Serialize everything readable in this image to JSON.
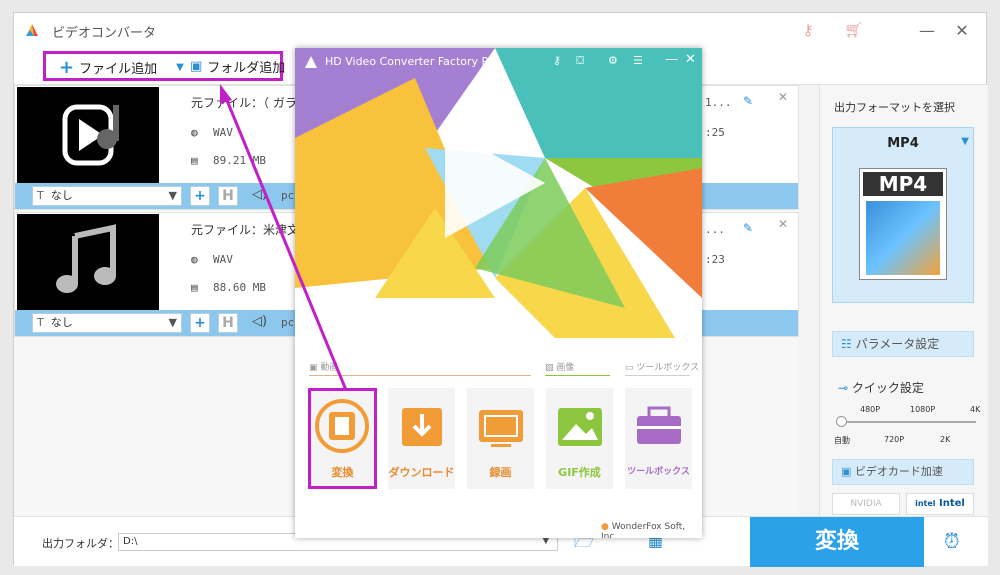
{
  "app": {
    "title": "ビデオコンバータ",
    "toolbar": {
      "add_file": "ファイル追加",
      "add_folder": "フォルダ追加"
    }
  },
  "files": [
    {
      "source_label": "元ファイル：（ ガラ",
      "format": "WAV",
      "size": "89.21 MB",
      "output_partial": "1...",
      "duration_partial": ":25",
      "subtitle": "なし",
      "audio_partial": "pcı"
    },
    {
      "source_label": "元ファイル：米津文",
      "format": "WAV",
      "size": "88.60 MB",
      "output_partial": "...",
      "duration_partial": ":23",
      "subtitle": "なし",
      "audio_partial": "pcı"
    }
  ],
  "right_panel": {
    "heading": "出力フォーマットを選択",
    "format": "MP4",
    "format_icon_text": "MP4",
    "param_button": "パラメータ設定",
    "quick_settings": "クイック設定",
    "quality_top": [
      "480P",
      "1080P",
      "4K"
    ],
    "quality_bottom": [
      "自動",
      "720P",
      "2K"
    ],
    "gpu_button": "ビデオカード加速",
    "nvidia": "NVIDIA",
    "intel_logo": "intel",
    "intel": "Intel"
  },
  "bottom": {
    "output_folder_label": "出力フォルダ：",
    "output_folder_value": "D:\\",
    "convert_button": "変換"
  },
  "launcher": {
    "title": "HD Video Converter Factory Pro",
    "categories": {
      "video": "動画",
      "image": "画像",
      "toolbox": "ツールボックス"
    },
    "tiles": [
      {
        "label": "変換",
        "icon": "film-icon"
      },
      {
        "label": "ダウンロード",
        "icon": "download-icon"
      },
      {
        "label": "録画",
        "icon": "screen-record-icon"
      },
      {
        "label": "GIF作成",
        "icon": "gif-image-icon"
      },
      {
        "label": "ツールボックス",
        "icon": "toolbox-icon"
      }
    ],
    "footer": "WonderFox Soft, Inc."
  },
  "colors": {
    "accent": "#2aa1e8",
    "highlight": "#c21fc9",
    "tile_orange": "#f29c38",
    "tile_green": "#8cc63f",
    "tile_purple": "#a66cc5"
  }
}
